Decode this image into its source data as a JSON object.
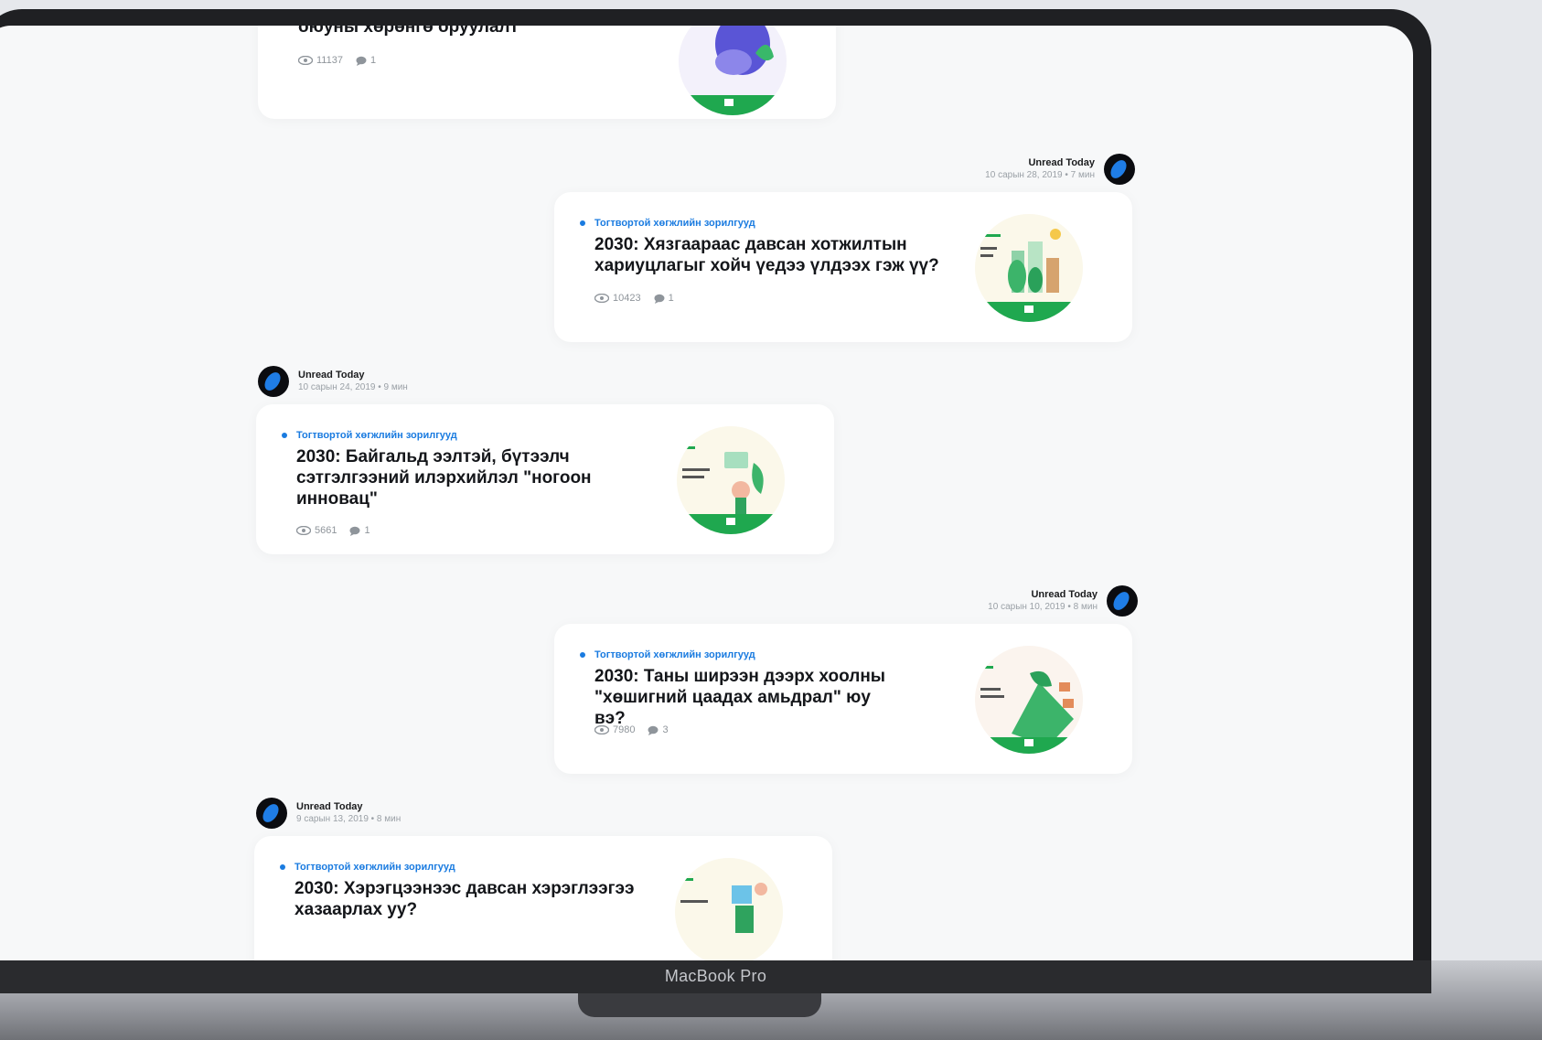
{
  "device": {
    "label": "MacBook Pro"
  },
  "feed": [
    {
      "author": "",
      "meta": "",
      "side": "left",
      "topic": "",
      "title": "оюуны хөрөнгө оруулалт",
      "views": "11137",
      "comments": "1"
    },
    {
      "author": "Unread Today",
      "meta": "10 сарын 28, 2019 • 7 мин",
      "side": "right",
      "topic": "Тогтвортой хөгжлийн зорилгууд",
      "title": "2030: Хязгаараас давсан хотжилтын хариуцлагыг хойч үедээ үлдээх гэж үү?",
      "views": "10423",
      "comments": "1"
    },
    {
      "author": "Unread Today",
      "meta": "10 сарын 24, 2019 • 9 мин",
      "side": "left",
      "topic": "Тогтвортой хөгжлийн зорилгууд",
      "title": "2030: Байгальд ээлтэй, бүтээлч сэтгэлгээний илэрхийлэл \"ногоон инновац\"",
      "views": "5661",
      "comments": "1"
    },
    {
      "author": "Unread Today",
      "meta": "10 сарын 10, 2019 • 8 мин",
      "side": "right",
      "topic": "Тогтвортой хөгжлийн зорилгууд",
      "title": "2030: Таны ширээн дээрх хоолны \"хөшигний цаадах амьдрал\" юу вэ?",
      "views": "7980",
      "comments": "3"
    },
    {
      "author": "Unread Today",
      "meta": "9 сарын 13, 2019 • 8 мин",
      "side": "left",
      "topic": "Тогтвортой хөгжлийн зорилгууд",
      "title": "2030: Хэрэгцээнээс давсан хэрэглээгээ хазаарлах уу?",
      "views": "",
      "comments": ""
    }
  ],
  "colors": {
    "accent": "#1a7be0",
    "brand_green": "#1fa84f",
    "screen_bg": "#f7f8f9"
  }
}
